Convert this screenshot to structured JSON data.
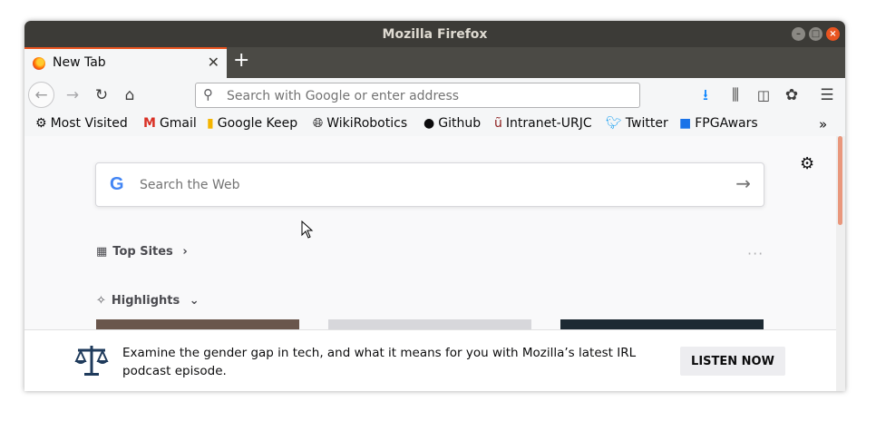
{
  "window": {
    "title": "Mozilla Firefox"
  },
  "tab": {
    "title": "New Tab"
  },
  "urlbar": {
    "placeholder": "Search with Google or enter address"
  },
  "bookmarks": [
    {
      "label": "Most Visited",
      "icon": "gear-icon"
    },
    {
      "label": "Gmail",
      "icon": "gmail-icon"
    },
    {
      "label": "Google Keep",
      "icon": "keep-icon"
    },
    {
      "label": "WikiRobotics",
      "icon": "globe-icon"
    },
    {
      "label": "Github",
      "icon": "github-icon"
    },
    {
      "label": "Intranet-URJC",
      "icon": "urjc-icon"
    },
    {
      "label": "Twitter",
      "icon": "twitter-icon"
    },
    {
      "label": "FPGAwars",
      "icon": "fpgawars-icon"
    }
  ],
  "newtab": {
    "search_placeholder": "Search the Web",
    "top_sites_label": "Top Sites",
    "highlights_label": "Highlights"
  },
  "promo": {
    "text": "Examine the gender gap in tech, and what it means for you with Mozilla’s latest IRL podcast episode.",
    "button_label": "LISTEN NOW"
  },
  "colors": {
    "accent": "#e95420",
    "titlebar": "#3c3b37",
    "link_blue": "#0a84ff"
  }
}
